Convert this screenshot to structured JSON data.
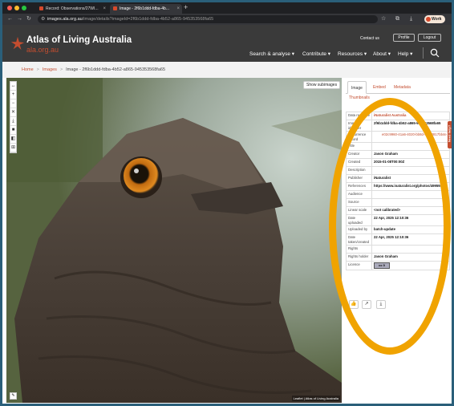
{
  "browser": {
    "tabs": [
      {
        "title": "Record: Observations/27WI...",
        "active": false
      },
      {
        "title": "Image - 2f6b1ddd-fdba-4b...",
        "active": true
      }
    ],
    "new_tab": "+",
    "url_host": "images.ala.org.au",
    "url_path": "/image/details?imageId=2f6b1ddd-fdba-4b52-a865-945353568fa65",
    "profile_label": "Work",
    "traffic_light_colors": [
      "#ff5f57",
      "#febc2e",
      "#28c840"
    ]
  },
  "site": {
    "title": "Atlas of Living Australia",
    "subtitle": "ala.org.au",
    "contact_label": "Contact us",
    "profile_label": "Profile",
    "logout_label": "Logout",
    "menu": [
      "Search & analyse ▾",
      "Contribute ▾",
      "Resources ▾",
      "About ▾",
      "Help ▾"
    ],
    "accent_color": "#c44d2f"
  },
  "breadcrumb": {
    "home": "Home",
    "images": "Images",
    "current": "Image - 2f6b1ddd-fdba-4b52-a865-945353568fa65"
  },
  "viewer": {
    "show_subimages_label": "Show subimages",
    "attribution": "Leaflet | Atlas of Living Australia",
    "controls": [
      "↔",
      "+",
      "−",
      "✕",
      "⤓",
      "■",
      "◧",
      "⊞"
    ]
  },
  "panel": {
    "tabs": [
      "Image",
      "Embed",
      "Metadata"
    ],
    "thumbnails_label": "Thumbnails",
    "rows": [
      {
        "key": "Data resource",
        "value": "iNaturalist Australia",
        "red": true
      },
      {
        "key": "Image identifier",
        "value": "2f6b1ddd-fdba-4b52-a865-945353568fa65",
        "red": false
      },
      {
        "key": "Occurrence record",
        "value": "e02c9960-41a6-4020-bb8d-40fb0817bb4e",
        "red": true,
        "list": true
      },
      {
        "key": "Title",
        "value": "",
        "red": false
      },
      {
        "key": "Creator",
        "value": "Jason Graham",
        "red": false
      },
      {
        "key": "Created",
        "value": "2015-01-08T00:00Z",
        "red": false
      },
      {
        "key": "Description",
        "value": "",
        "red": false
      },
      {
        "key": "Publisher",
        "value": "iNaturalist",
        "red": false
      },
      {
        "key": "References",
        "value": "https://www.inaturalist.org/photos/4995944",
        "red": false
      },
      {
        "key": "Audience",
        "value": "",
        "red": false
      },
      {
        "key": "Source",
        "value": "",
        "red": false
      },
      {
        "key": "Linear scale",
        "value": "<not calibrated>",
        "red": false
      },
      {
        "key": "Date uploaded",
        "value": "22 Apr, 2025 12:10:36",
        "red": false
      },
      {
        "key": "Uploaded by",
        "value": "batch-update",
        "red": false
      },
      {
        "key": "Date taken/created",
        "value": "22 Apr, 2025 12:10:36",
        "red": false
      },
      {
        "key": "Rights",
        "value": "",
        "red": false
      },
      {
        "key": "Rights holder",
        "value": "Jason Graham",
        "red": false
      },
      {
        "key": "Licence",
        "value": "",
        "red": false,
        "cc": true
      }
    ],
    "licence_badge": "cc 0",
    "feedback_label": "Need help?"
  }
}
